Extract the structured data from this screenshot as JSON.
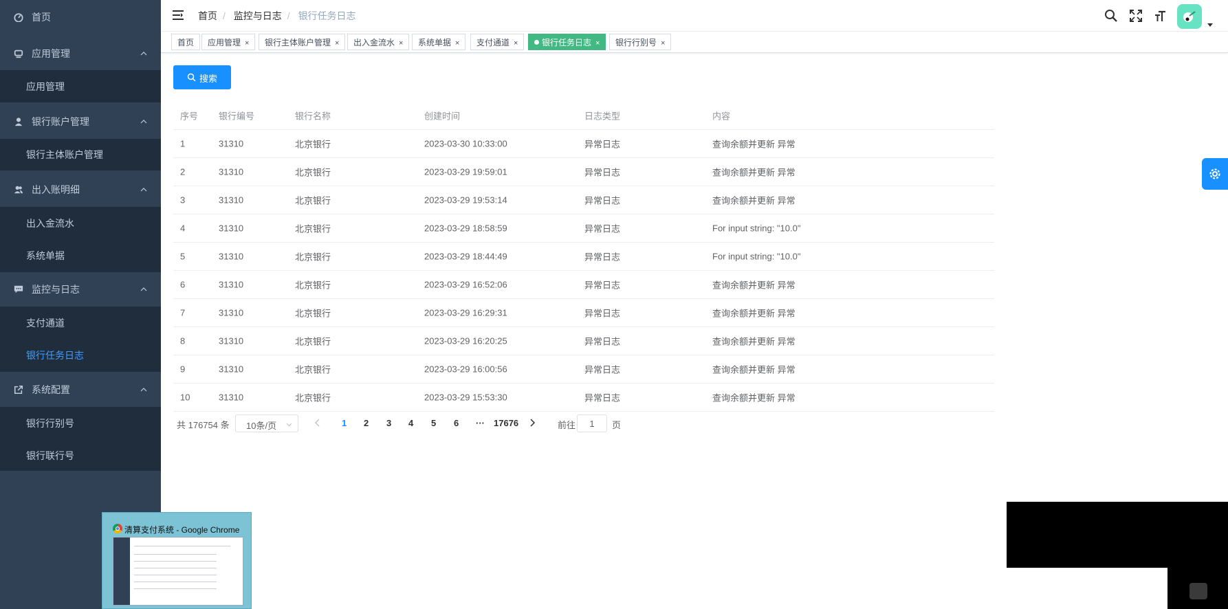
{
  "sidebar": {
    "home": "首页",
    "groups": [
      {
        "label": "应用管理",
        "icon": "app-icon",
        "items": [
          "应用管理"
        ]
      },
      {
        "label": "银行账户管理",
        "icon": "user-icon",
        "items": [
          "银行主体账户管理"
        ]
      },
      {
        "label": "出入账明细",
        "icon": "users-icon",
        "items": [
          "出入金流水",
          "系统单据"
        ]
      },
      {
        "label": "监控与日志",
        "icon": "chat-icon",
        "items": [
          "支付通道",
          "银行任务日志"
        ]
      },
      {
        "label": "系统配置",
        "icon": "external-link-icon",
        "items": [
          "银行行别号",
          "银行联行号"
        ]
      }
    ],
    "active_item": "银行任务日志"
  },
  "breadcrumb": [
    "首页",
    "监控与日志",
    "银行任务日志"
  ],
  "tags": [
    {
      "label": "首页",
      "closable": false,
      "active": false
    },
    {
      "label": "应用管理",
      "closable": true,
      "active": false
    },
    {
      "label": "银行主体账户管理",
      "closable": true,
      "active": false
    },
    {
      "label": "出入金流水",
      "closable": true,
      "active": false
    },
    {
      "label": "系统单据",
      "closable": true,
      "active": false
    },
    {
      "label": "支付通道",
      "closable": true,
      "active": false
    },
    {
      "label": "银行任务日志",
      "closable": true,
      "active": true
    },
    {
      "label": "银行行别号",
      "closable": true,
      "active": false
    }
  ],
  "close_glyph": "×",
  "search_button": "搜索",
  "table": {
    "columns": [
      "序号",
      "银行编号",
      "银行名称",
      "创建时间",
      "日志类型",
      "内容"
    ],
    "rows": [
      [
        "1",
        "31310",
        "北京银行",
        "2023-03-30 10:33:00",
        "异常日志",
        "查询余额并更新 异常"
      ],
      [
        "2",
        "31310",
        "北京银行",
        "2023-03-29 19:59:01",
        "异常日志",
        "查询余额并更新 异常"
      ],
      [
        "3",
        "31310",
        "北京银行",
        "2023-03-29 19:53:14",
        "异常日志",
        "查询余额并更新 异常"
      ],
      [
        "4",
        "31310",
        "北京银行",
        "2023-03-29 18:58:59",
        "异常日志",
        "For input string: \"10.0\""
      ],
      [
        "5",
        "31310",
        "北京银行",
        "2023-03-29 18:44:49",
        "异常日志",
        "For input string: \"10.0\""
      ],
      [
        "6",
        "31310",
        "北京银行",
        "2023-03-29 16:52:06",
        "异常日志",
        "查询余额并更新 异常"
      ],
      [
        "7",
        "31310",
        "北京银行",
        "2023-03-29 16:29:31",
        "异常日志",
        "查询余额并更新 异常"
      ],
      [
        "8",
        "31310",
        "北京银行",
        "2023-03-29 16:20:25",
        "异常日志",
        "查询余额并更新 异常"
      ],
      [
        "9",
        "31310",
        "北京银行",
        "2023-03-29 16:00:56",
        "异常日志",
        "查询余额并更新 异常"
      ],
      [
        "10",
        "31310",
        "北京银行",
        "2023-03-29 15:53:30",
        "异常日志",
        "查询余额并更新 异常"
      ]
    ]
  },
  "pagination": {
    "total": "共 176754 条",
    "page_size": "10条/页",
    "pages": [
      "1",
      "2",
      "3",
      "4",
      "5",
      "6"
    ],
    "ellipsis": "···",
    "last_page": "17676",
    "current": "1",
    "goto_prefix": "前往",
    "goto_value": "1",
    "goto_suffix": "页"
  },
  "taskbar_thumb": {
    "title": "清算支付系统 - Google Chrome"
  },
  "colors": {
    "sidebar_bg": "#304156",
    "submenu_bg": "#1f2d3d",
    "accent": "#1890ff",
    "active_tag": "#42b983"
  }
}
